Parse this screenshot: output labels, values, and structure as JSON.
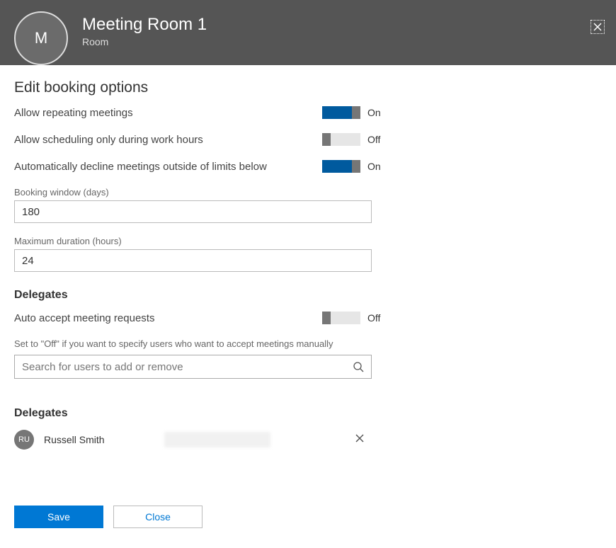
{
  "header": {
    "avatar_initial": "M",
    "title": "Meeting Room 1",
    "subtitle": "Room"
  },
  "section_title": "Edit booking options",
  "toggles": {
    "repeating": {
      "label": "Allow repeating meetings",
      "state": "On",
      "on": true
    },
    "work_hours": {
      "label": "Allow scheduling only during work hours",
      "state": "Off",
      "on": false
    },
    "auto_decline": {
      "label": "Automatically decline meetings outside of limits below",
      "state": "On",
      "on": true
    },
    "auto_accept": {
      "label": "Auto accept meeting requests",
      "state": "Off",
      "on": false
    }
  },
  "fields": {
    "booking_window": {
      "label": "Booking window (days)",
      "value": "180"
    },
    "max_duration": {
      "label": "Maximum duration (hours)",
      "value": "24"
    }
  },
  "delegates_heading": "Delegates",
  "auto_accept_help": "Set to \"Off\" if you want to specify users who want to accept meetings manually",
  "search_placeholder": "Search for users to add or remove",
  "delegates_list_heading": "Delegates",
  "delegates": [
    {
      "initials": "RU",
      "name": "Russell Smith"
    }
  ],
  "buttons": {
    "save": "Save",
    "close": "Close"
  }
}
